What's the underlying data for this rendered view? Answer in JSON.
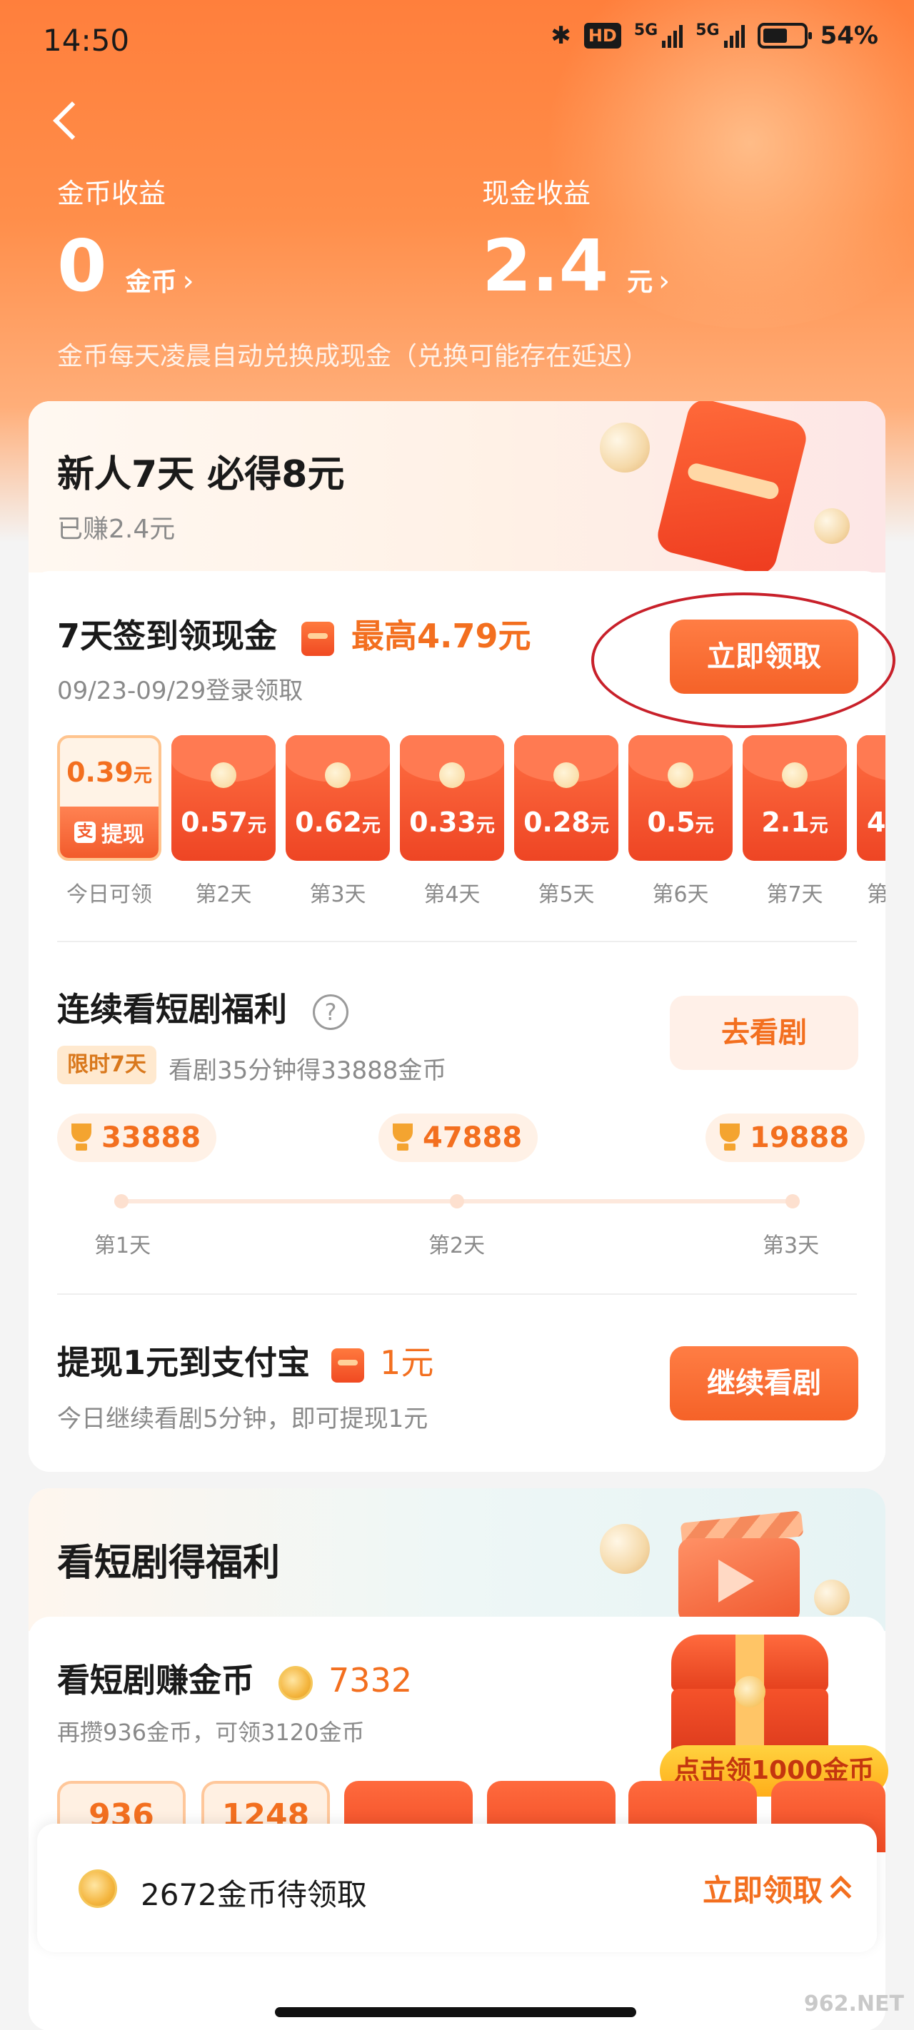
{
  "status_bar": {
    "time": "14:50",
    "hd": "HD",
    "net1": "5G",
    "net2": "5G",
    "battery": "54%"
  },
  "header": {
    "coin_label": "金币收益",
    "coin_value": "0",
    "coin_unit": "金币",
    "cash_label": "现金收益",
    "cash_value": "2.4",
    "cash_unit": "元",
    "hint": "金币每天凌晨自动兑换成现金（兑换可能存在延迟）"
  },
  "newbie": {
    "title": "新人7天 必得8元",
    "earned": "已赚2.4元"
  },
  "checkin": {
    "title": "7天签到领现金",
    "max": "最高4.79元",
    "date_range": "09/23-09/29登录领取",
    "button": "立即领取",
    "today": {
      "amount": "0.39",
      "unit": "元",
      "withdraw": "提现",
      "label": "今日可领"
    },
    "days": [
      {
        "amount": "0.57",
        "unit": "元",
        "label": "第2天"
      },
      {
        "amount": "0.62",
        "unit": "元",
        "label": "第3天"
      },
      {
        "amount": "0.33",
        "unit": "元",
        "label": "第4天"
      },
      {
        "amount": "0.28",
        "unit": "元",
        "label": "第5天"
      },
      {
        "amount": "0.5",
        "unit": "元",
        "label": "第6天"
      },
      {
        "amount": "2.1",
        "unit": "元",
        "label": "第7天"
      },
      {
        "amount": "4",
        "unit": "",
        "label": "第"
      }
    ]
  },
  "series_bonus": {
    "title": "连续看短剧福利",
    "help": "?",
    "tag": "限时7天",
    "desc": "看剧35分钟得33888金币",
    "button": "去看剧",
    "rewards": [
      {
        "value": "33888",
        "label": "第1天"
      },
      {
        "value": "47888",
        "label": "第2天"
      },
      {
        "value": "19888",
        "label": "第3天"
      }
    ]
  },
  "alipay": {
    "title": "提现1元到支付宝",
    "amount": "1元",
    "desc": "今日继续看剧5分钟，即可提现1元",
    "button": "继续看剧"
  },
  "drama_welfare": {
    "title": "看短剧得福利"
  },
  "drama_coins": {
    "title": "看短剧赚金币",
    "coins": "7332",
    "desc": "再攒936金币，可领3120金币",
    "chest_badge": "点击领1000金币",
    "tiers": [
      "936",
      "1248"
    ]
  },
  "bottom_bar": {
    "text": "2672金币待领取",
    "claim": "立即领取"
  },
  "watermark": "962.NET",
  "colors": {
    "accent": "#f36f1f",
    "primary_button": "#f56228",
    "highlight_ring": "#c8202a"
  }
}
